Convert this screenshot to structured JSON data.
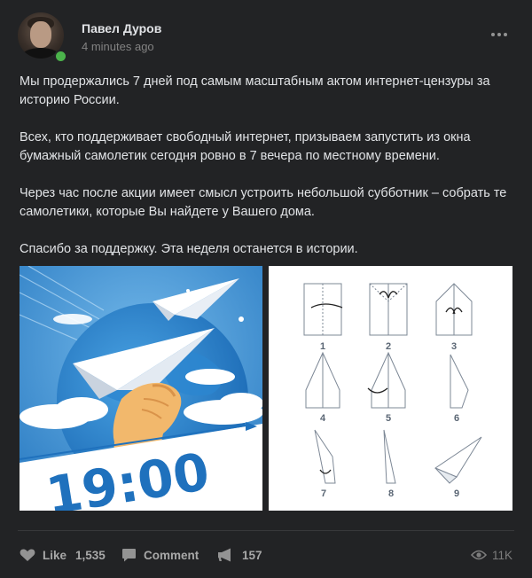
{
  "post": {
    "author": "Павел Дуров",
    "time": "4 minutes ago",
    "paragraphs": [
      "Мы продержались 7 дней под самым масштабным актом интернет-цензуры за историю России.",
      "Всех, кто поддерживает свободный интернет, призываем запустить из окна бумажный самолетик сегодня ровно в 7 вечера по местному времени.",
      "Через час после акции имеет смысл устроить небольшой субботник – собрать те самолетики, которые Вы найдете у Вашего дома.",
      "Спасибо за поддержку. Эта неделя останется в истории."
    ],
    "photo1": {
      "time_text": "19:00"
    },
    "photo2": {
      "steps": [
        "1",
        "2",
        "3",
        "4",
        "5",
        "6",
        "7",
        "8",
        "9"
      ]
    }
  },
  "actions": {
    "like_label": "Like",
    "like_count": "1,535",
    "comment_label": "Comment",
    "share_count": "157",
    "views_count": "11K"
  },
  "colors": {
    "background": "#222325",
    "text": "#e1e3e6",
    "muted": "#828282",
    "online": "#4bb34b"
  }
}
